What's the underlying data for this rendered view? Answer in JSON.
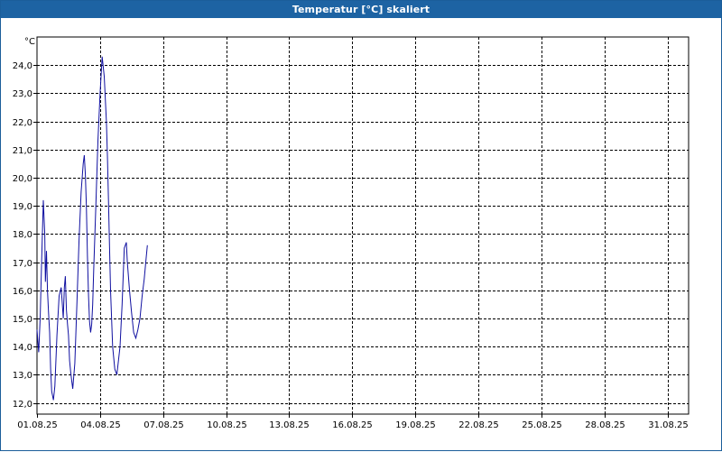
{
  "window": {
    "title": "Temperatur [°C] skaliert"
  },
  "chart_data": {
    "type": "line",
    "title": "Temperatur [°C] skaliert",
    "ylabel": "°C",
    "xlabel": "",
    "ylim": [
      11.6,
      25.0
    ],
    "xlim": [
      0,
      31
    ],
    "x_ticks": [
      {
        "day": 0,
        "label": "01.08.25"
      },
      {
        "day": 3,
        "label": "04.08.25"
      },
      {
        "day": 6,
        "label": "07.08.25"
      },
      {
        "day": 9,
        "label": "10.08.25"
      },
      {
        "day": 12,
        "label": "13.08.25"
      },
      {
        "day": 15,
        "label": "16.08.25"
      },
      {
        "day": 18,
        "label": "19.08.25"
      },
      {
        "day": 21,
        "label": "22.08.25"
      },
      {
        "day": 24,
        "label": "25.08.25"
      },
      {
        "day": 27,
        "label": "28.08.25"
      },
      {
        "day": 30,
        "label": "31.08.25"
      }
    ],
    "y_ticks": [
      {
        "value": 12,
        "label": "12,0"
      },
      {
        "value": 13,
        "label": "13,0"
      },
      {
        "value": 14,
        "label": "14,0"
      },
      {
        "value": 15,
        "label": "15,0"
      },
      {
        "value": 16,
        "label": "16,0"
      },
      {
        "value": 17,
        "label": "17,0"
      },
      {
        "value": 18,
        "label": "18,0"
      },
      {
        "value": 19,
        "label": "19,0"
      },
      {
        "value": 20,
        "label": "20,0"
      },
      {
        "value": 21,
        "label": "21,0"
      },
      {
        "value": 22,
        "label": "22,0"
      },
      {
        "value": 23,
        "label": "23,0"
      },
      {
        "value": 24,
        "label": "24,0"
      }
    ],
    "grid": true,
    "series": [
      {
        "color": "#1010a0",
        "x": [
          0.0,
          0.08,
          0.15,
          0.22,
          0.3,
          0.37,
          0.4,
          0.45,
          0.5,
          0.55,
          0.6,
          0.65,
          0.7,
          0.78,
          0.85,
          0.95,
          1.05,
          1.15,
          1.25,
          1.3,
          1.35,
          1.4,
          1.45,
          1.5,
          1.55,
          1.6,
          1.65,
          1.7,
          1.8,
          1.9,
          2.0,
          2.1,
          2.2,
          2.25,
          2.3,
          2.35,
          2.4,
          2.45,
          2.5,
          2.55,
          2.6,
          2.65,
          2.7,
          2.8,
          2.9,
          3.0,
          3.1,
          3.2,
          3.3,
          3.35,
          3.4,
          3.45,
          3.5,
          3.6,
          3.7,
          3.8,
          3.95,
          4.05,
          4.15,
          4.25,
          4.3,
          4.4,
          4.5,
          4.6,
          4.7,
          4.8,
          4.9,
          5.0,
          5.1,
          5.2,
          5.25
        ],
        "values": [
          14.6,
          13.8,
          15.0,
          17.0,
          19.2,
          18.0,
          16.3,
          17.4,
          16.0,
          15.2,
          14.5,
          13.2,
          12.4,
          12.1,
          12.6,
          14.4,
          15.8,
          16.1,
          15.0,
          16.1,
          16.5,
          15.3,
          14.8,
          14.4,
          13.5,
          13.1,
          12.8,
          12.5,
          13.4,
          15.6,
          17.8,
          19.5,
          20.5,
          20.8,
          20.1,
          19.0,
          17.2,
          15.8,
          14.9,
          14.5,
          14.8,
          15.5,
          16.8,
          19.0,
          21.3,
          23.0,
          24.3,
          23.6,
          22.0,
          20.8,
          19.2,
          17.5,
          16.0,
          14.0,
          13.2,
          13.0,
          14.0,
          15.5,
          17.5,
          17.7,
          17.0,
          16.0,
          15.2,
          14.5,
          14.3,
          14.6,
          15.0,
          15.8,
          16.4,
          17.2,
          17.6
        ]
      }
    ]
  }
}
